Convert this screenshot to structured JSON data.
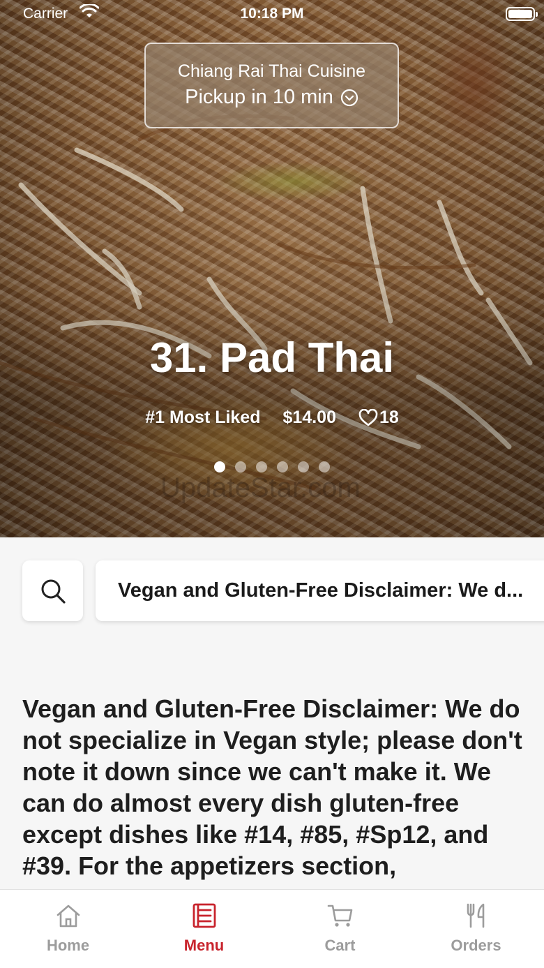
{
  "status_bar": {
    "carrier": "Carrier",
    "time": "10:18 PM"
  },
  "restaurant": {
    "name": "Chiang Rai Thai Cuisine",
    "pickup": "Pickup in 10 min"
  },
  "featured": {
    "dish_name": "31. Pad Thai",
    "rank": "#1 Most Liked",
    "price": "$14.00",
    "likes": "18",
    "slide_count": 6,
    "active_slide": 1,
    "watermark": "UpdateStar.com"
  },
  "search": {
    "icon": "search-icon"
  },
  "category_chip": {
    "label": "Vegan and Gluten-Free Disclaimer: We d..."
  },
  "disclaimer": {
    "text": "Vegan and Gluten-Free Disclaimer: We do not specialize in Vegan style; please don't note it down since we can't make it. We can do almost every dish gluten-free except dishes like #14, #85, #Sp12, and #39. For the appetizers section,"
  },
  "tabs": [
    {
      "label": "Home",
      "icon": "home-icon",
      "active": false
    },
    {
      "label": "Menu",
      "icon": "menu-icon",
      "active": true
    },
    {
      "label": "Cart",
      "icon": "cart-icon",
      "active": false
    },
    {
      "label": "Orders",
      "icon": "utensils-icon",
      "active": false
    }
  ],
  "colors": {
    "accent": "#c8232c",
    "tab_inactive": "#9c9c9c"
  }
}
